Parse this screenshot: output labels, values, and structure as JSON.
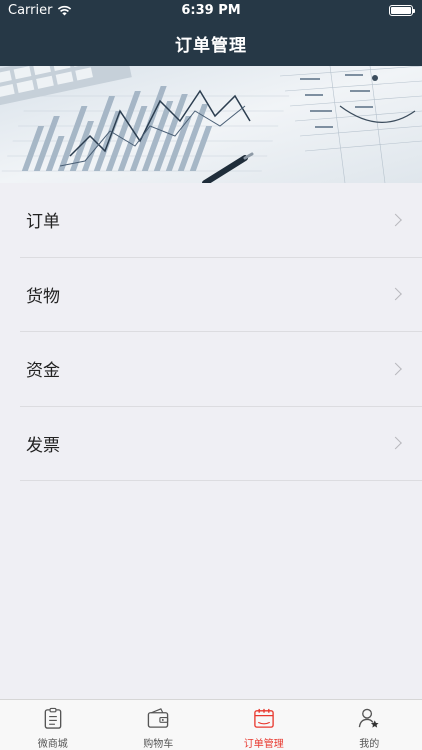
{
  "status_bar": {
    "carrier": "Carrier",
    "time": "6:39 PM"
  },
  "nav": {
    "title": "订单管理"
  },
  "banner": {
    "icon": "financial-chart-photo"
  },
  "menu": {
    "items": [
      {
        "label": "订单"
      },
      {
        "label": "货物"
      },
      {
        "label": "资金"
      },
      {
        "label": "发票"
      }
    ]
  },
  "tabbar": {
    "items": [
      {
        "label": "微商城",
        "icon": "clipboard-icon"
      },
      {
        "label": "购物车",
        "icon": "wallet-icon"
      },
      {
        "label": "订单管理",
        "icon": "calendar-icon",
        "active": true
      },
      {
        "label": "我的",
        "icon": "user-star-icon"
      }
    ],
    "active_color": "#e8392f"
  },
  "colors": {
    "header_bg": "#263846",
    "page_bg": "#efeff4"
  }
}
